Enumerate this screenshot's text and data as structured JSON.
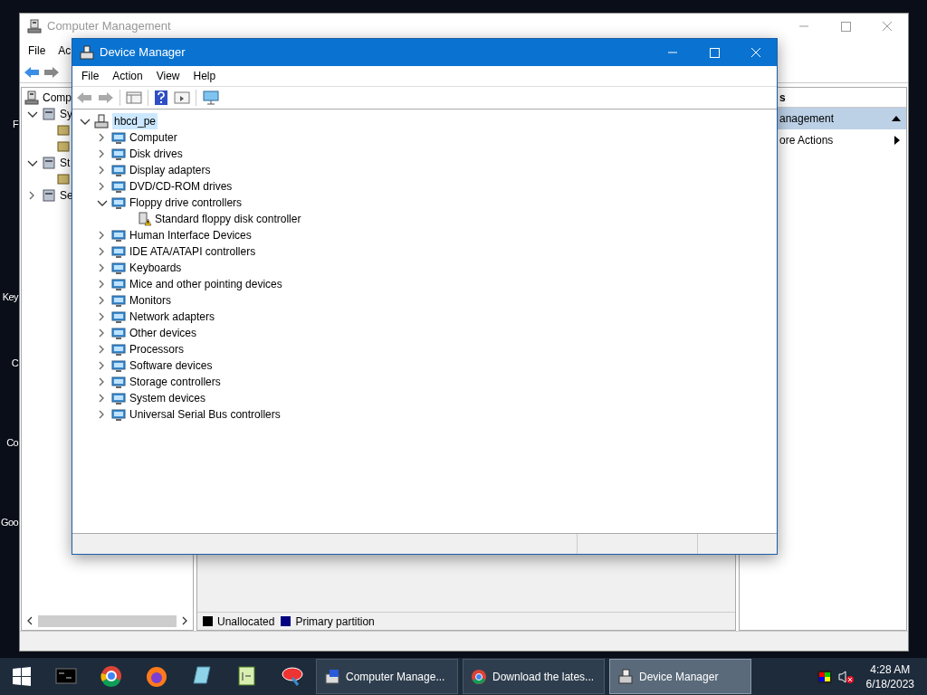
{
  "desktop_labels": [
    "F",
    "Key",
    "C",
    "Co",
    "Goo"
  ],
  "computer_management": {
    "title": "Computer Management",
    "menu": [
      "File",
      "Ac"
    ],
    "tree": [
      {
        "label": "Comp"
      },
      {
        "label": "Sy",
        "expanded": true,
        "children": [
          {
            "kind": "icon_only"
          },
          {
            "kind": "icon_only"
          }
        ]
      },
      {
        "label": "St",
        "expanded": true,
        "children": [
          {
            "kind": "icon_only"
          }
        ]
      },
      {
        "label": "Se",
        "expanded": false
      }
    ],
    "actions": {
      "header": "s",
      "items": [
        {
          "label": "anagement",
          "selected": true
        },
        {
          "label": "ore Actions",
          "selected": false
        }
      ]
    },
    "legend": [
      {
        "label": "Unallocated",
        "color": "#000000"
      },
      {
        "label": "Primary partition",
        "color": "#000080"
      }
    ]
  },
  "device_manager": {
    "title": "Device Manager",
    "menu": [
      "File",
      "Action",
      "View",
      "Help"
    ],
    "tree": {
      "label": "hbcd_pe",
      "expanded": true,
      "selected": true,
      "children": [
        {
          "label": "Computer",
          "expanded": false
        },
        {
          "label": "Disk drives",
          "expanded": false
        },
        {
          "label": "Display adapters",
          "expanded": false
        },
        {
          "label": "DVD/CD-ROM drives",
          "expanded": false
        },
        {
          "label": "Floppy drive controllers",
          "expanded": true,
          "children": [
            {
              "label": "Standard floppy disk controller",
              "warning": true
            }
          ]
        },
        {
          "label": "Human Interface Devices",
          "expanded": false
        },
        {
          "label": "IDE ATA/ATAPI controllers",
          "expanded": false
        },
        {
          "label": "Keyboards",
          "expanded": false
        },
        {
          "label": "Mice and other pointing devices",
          "expanded": false
        },
        {
          "label": "Monitors",
          "expanded": false
        },
        {
          "label": "Network adapters",
          "expanded": false
        },
        {
          "label": "Other devices",
          "expanded": false
        },
        {
          "label": "Processors",
          "expanded": false
        },
        {
          "label": "Software devices",
          "expanded": false
        },
        {
          "label": "Storage controllers",
          "expanded": false
        },
        {
          "label": "System devices",
          "expanded": false
        },
        {
          "label": "Universal Serial Bus controllers",
          "expanded": false
        }
      ]
    }
  },
  "taskbar": {
    "tasks": [
      {
        "label": "Computer Manage...",
        "selected": false
      },
      {
        "label": "Download the lates...",
        "selected": false
      },
      {
        "label": "Device Manager",
        "selected": true
      }
    ],
    "time": "4:28 AM",
    "date": "6/18/2023"
  }
}
